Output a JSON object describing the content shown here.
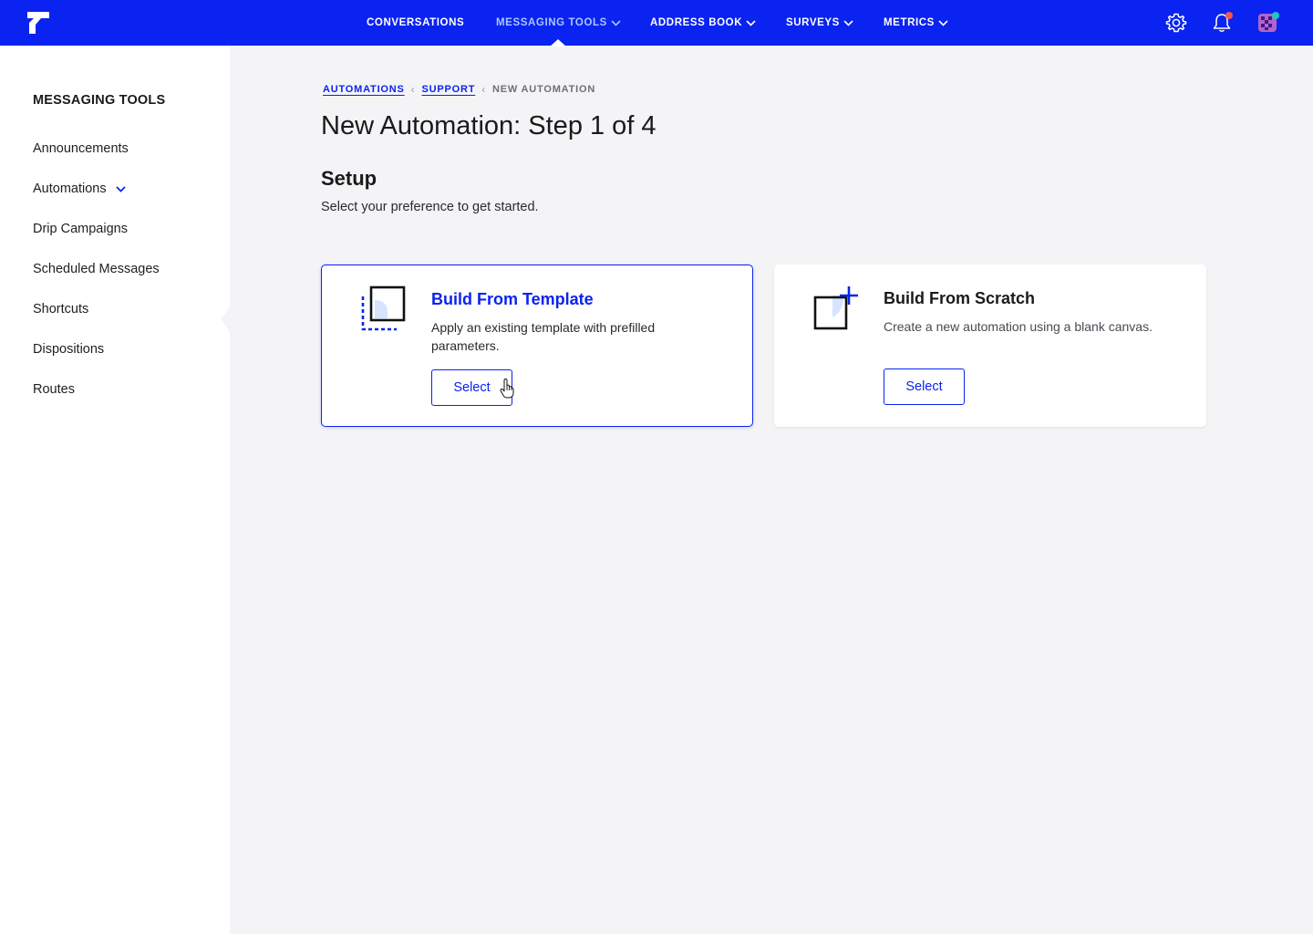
{
  "topnav": {
    "items": [
      {
        "label": "CONVERSATIONS"
      },
      {
        "label": "MESSAGING TOOLS"
      },
      {
        "label": "ADDRESS BOOK"
      },
      {
        "label": "SURVEYS"
      },
      {
        "label": "METRICS"
      }
    ],
    "active_index": 1,
    "icons": [
      "logo-icon",
      "settings-gear-icon",
      "notification-bell-icon",
      "user-avatar-icon"
    ]
  },
  "sidebar": {
    "title": "MESSAGING TOOLS",
    "items": [
      {
        "label": "Announcements"
      },
      {
        "label": "Automations"
      },
      {
        "label": "Drip Campaigns"
      },
      {
        "label": "Scheduled Messages"
      },
      {
        "label": "Shortcuts"
      },
      {
        "label": "Dispositions"
      },
      {
        "label": "Routes"
      }
    ]
  },
  "breadcrumb": {
    "items": [
      {
        "label": "AUTOMATIONS"
      },
      {
        "label": "SUPPORT"
      },
      {
        "label": "NEW AUTOMATION"
      }
    ]
  },
  "page": {
    "title": "New Automation: Step 1 of 4",
    "section_title": "Setup",
    "section_desc": "Select your preference to get started."
  },
  "cards": [
    {
      "title": "Build From Template",
      "text": "Apply an existing template with prefilled parameters.",
      "button": "Select",
      "selected": true
    },
    {
      "title": "Build From Scratch",
      "text": "Create a new automation using a blank canvas.",
      "button": "Select",
      "selected": false
    }
  ],
  "colors": {
    "brand": "#0a23f0",
    "background": "#f4f4f7",
    "nav_active": "#a9c6ff",
    "notification_dot": "#f25a4a",
    "status_dot": "#22c4c9"
  }
}
